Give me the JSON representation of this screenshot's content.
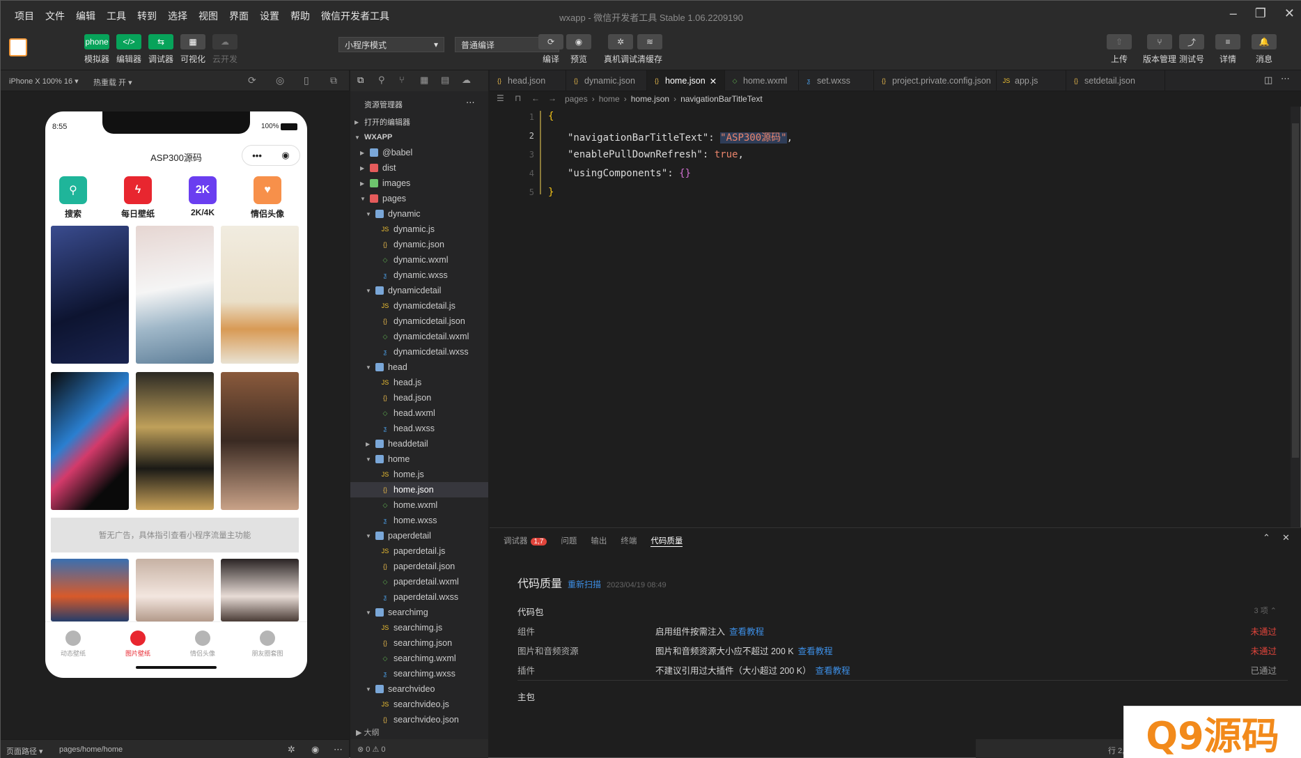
{
  "menu": [
    "项目",
    "文件",
    "编辑",
    "工具",
    "转到",
    "选择",
    "视图",
    "界面",
    "设置",
    "帮助",
    "微信开发者工具"
  ],
  "window_title": "wxapp - 微信开发者工具 Stable 1.06.2209190",
  "toolbar": {
    "left": [
      {
        "label": "模拟器",
        "icon": "phone"
      },
      {
        "label": "编辑器",
        "icon": "</>"
      },
      {
        "label": "调试器",
        "icon": "⇆"
      },
      {
        "label": "可视化",
        "icon": "▦"
      },
      {
        "label": "云开发",
        "icon": "☁"
      }
    ],
    "mode_select": "小程序模式",
    "compile_select": "普通编译",
    "mid": [
      {
        "label": "编译",
        "icon": "⟳"
      },
      {
        "label": "预览",
        "icon": "◉"
      },
      {
        "label": "真机调试",
        "icon": "✲"
      },
      {
        "label": "清缓存",
        "icon": "≋"
      }
    ],
    "right": [
      {
        "label": "上传",
        "icon": "⇧"
      },
      {
        "label": "版本管理",
        "icon": "⑂"
      },
      {
        "label": "测试号",
        "icon": "⤴"
      },
      {
        "label": "详情",
        "icon": "≡"
      },
      {
        "label": "消息",
        "icon": "🔔"
      }
    ]
  },
  "sim": {
    "device": "iPhone X 100% 16 ▾",
    "hotreload": "热重载 开 ▾",
    "time": "8:55",
    "battery": "100%",
    "nav_title": "ASP300源码",
    "quick": [
      {
        "label": "搜索",
        "color": "#1fb59a",
        "icon": "⚲"
      },
      {
        "label": "每日壁纸",
        "color": "#e8262f",
        "icon": "ϟ"
      },
      {
        "label": "2K/4K",
        "color": "#6a3ef0",
        "icon": "2K"
      },
      {
        "label": "情侣头像",
        "color": "#f7904a",
        "icon": "♥"
      }
    ],
    "ad": "暂无广告，具体指引查看小程序流量主功能",
    "tabs": [
      "动态壁纸",
      "图片壁纸",
      "情侣头像",
      "朋友圈套图"
    ],
    "footer_path_label": "页面路径 ▾",
    "footer_path": "pages/home/home"
  },
  "explorer": {
    "title": "资源管理器",
    "open_editors": "打开的编辑器",
    "root": "WXAPP",
    "items": [
      {
        "t": "@babel",
        "d": 1,
        "k": "folder",
        "o": false
      },
      {
        "t": "dist",
        "d": 1,
        "k": "folderred",
        "o": false
      },
      {
        "t": "images",
        "d": 1,
        "k": "foldergreen",
        "o": false
      },
      {
        "t": "pages",
        "d": 1,
        "k": "folderred",
        "o": true
      },
      {
        "t": "dynamic",
        "d": 2,
        "k": "folder",
        "o": true
      },
      {
        "t": "dynamic.js",
        "d": 3,
        "k": "js"
      },
      {
        "t": "dynamic.json",
        "d": 3,
        "k": "json"
      },
      {
        "t": "dynamic.wxml",
        "d": 3,
        "k": "wxml"
      },
      {
        "t": "dynamic.wxss",
        "d": 3,
        "k": "wxss"
      },
      {
        "t": "dynamicdetail",
        "d": 2,
        "k": "folder",
        "o": true
      },
      {
        "t": "dynamicdetail.js",
        "d": 3,
        "k": "js"
      },
      {
        "t": "dynamicdetail.json",
        "d": 3,
        "k": "json"
      },
      {
        "t": "dynamicdetail.wxml",
        "d": 3,
        "k": "wxml"
      },
      {
        "t": "dynamicdetail.wxss",
        "d": 3,
        "k": "wxss"
      },
      {
        "t": "head",
        "d": 2,
        "k": "folder",
        "o": true
      },
      {
        "t": "head.js",
        "d": 3,
        "k": "js"
      },
      {
        "t": "head.json",
        "d": 3,
        "k": "json"
      },
      {
        "t": "head.wxml",
        "d": 3,
        "k": "wxml"
      },
      {
        "t": "head.wxss",
        "d": 3,
        "k": "wxss"
      },
      {
        "t": "headdetail",
        "d": 2,
        "k": "folder",
        "o": false
      },
      {
        "t": "home",
        "d": 2,
        "k": "folder",
        "o": true
      },
      {
        "t": "home.js",
        "d": 3,
        "k": "js"
      },
      {
        "t": "home.json",
        "d": 3,
        "k": "json",
        "active": true
      },
      {
        "t": "home.wxml",
        "d": 3,
        "k": "wxml"
      },
      {
        "t": "home.wxss",
        "d": 3,
        "k": "wxss"
      },
      {
        "t": "paperdetail",
        "d": 2,
        "k": "folder",
        "o": true
      },
      {
        "t": "paperdetail.js",
        "d": 3,
        "k": "js"
      },
      {
        "t": "paperdetail.json",
        "d": 3,
        "k": "json"
      },
      {
        "t": "paperdetail.wxml",
        "d": 3,
        "k": "wxml"
      },
      {
        "t": "paperdetail.wxss",
        "d": 3,
        "k": "wxss"
      },
      {
        "t": "searchimg",
        "d": 2,
        "k": "folder",
        "o": true
      },
      {
        "t": "searchimg.js",
        "d": 3,
        "k": "js"
      },
      {
        "t": "searchimg.json",
        "d": 3,
        "k": "json"
      },
      {
        "t": "searchimg.wxml",
        "d": 3,
        "k": "wxml"
      },
      {
        "t": "searchimg.wxss",
        "d": 3,
        "k": "wxss"
      },
      {
        "t": "searchvideo",
        "d": 2,
        "k": "folder",
        "o": true
      },
      {
        "t": "searchvideo.js",
        "d": 3,
        "k": "js"
      },
      {
        "t": "searchvideo.json",
        "d": 3,
        "k": "json"
      }
    ],
    "outline": "大纲",
    "errors": "⊗ 0 ⚠ 0"
  },
  "tabs": [
    {
      "t": "head.json",
      "k": "json"
    },
    {
      "t": "dynamic.json",
      "k": "json"
    },
    {
      "t": "home.json",
      "k": "json",
      "act": true
    },
    {
      "t": "home.wxml",
      "k": "wxml"
    },
    {
      "t": "set.wxss",
      "k": "wxss"
    },
    {
      "t": "project.private.config.json",
      "k": "json"
    },
    {
      "t": "app.js",
      "k": "js"
    },
    {
      "t": "setdetail.json",
      "k": "json"
    }
  ],
  "breadcrumb": [
    "pages",
    "home",
    "home.json",
    "navigationBarTitleText"
  ],
  "code": {
    "lines": [
      "1",
      "2",
      "3",
      "4",
      "5"
    ],
    "open": "{",
    "close": "}",
    "key1": "\"navigationBarTitleText\"",
    "val1": "\"ASP300源码\"",
    "key2": "\"enablePullDownRefresh\"",
    "val2": "true",
    "key3": "\"usingComponents\"",
    "val3": "{}"
  },
  "panel": {
    "tabs": [
      "调试器",
      "问题",
      "输出",
      "终端",
      "代码质量"
    ],
    "badge": "1,7",
    "title": "代码质量",
    "rescan": "重新扫描",
    "time": "2023/04/19 08:49",
    "section": "代码包",
    "count": "3 项 ⌃",
    "rows": [
      {
        "name": "组件",
        "desc": "启用组件按需注入",
        "link": "查看教程",
        "status": "未通过",
        "fail": true
      },
      {
        "name": "图片和音频资源",
        "desc": "图片和音频资源大小应不超过 200 K",
        "link": "查看教程",
        "status": "未通过",
        "fail": true
      },
      {
        "name": "插件",
        "desc": "不建议引用过大插件（大小超过 200 K）",
        "link": "查看教程",
        "status": "已通过",
        "fail": false
      }
    ],
    "main": "主包"
  },
  "status": "行 2,",
  "watermark": "Q9源码"
}
